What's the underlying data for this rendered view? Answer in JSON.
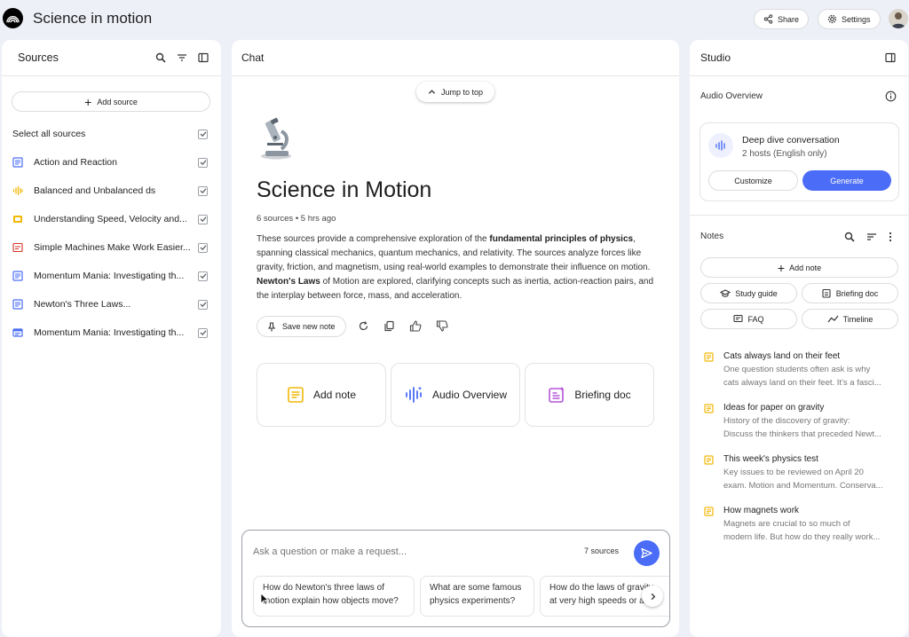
{
  "app": {
    "title": "Science in motion"
  },
  "header": {
    "share_label": "Share",
    "settings_label": "Settings"
  },
  "sources": {
    "title": "Sources",
    "add_label": "Add source",
    "select_all_label": "Select all sources",
    "items": [
      {
        "label": "Action and Reaction",
        "icon": "doc-icon",
        "color": "#4a6cf7"
      },
      {
        "label": "Balanced and Unbalanced ds",
        "icon": "audio-icon",
        "color": "#f2b807"
      },
      {
        "label": "Understanding Speed, Velocity and...",
        "icon": "slides-icon",
        "color": "#f2b807"
      },
      {
        "label": "Simple Machines Make Work Easier...",
        "icon": "pdf-icon",
        "color": "#d93025"
      },
      {
        "label": "Momentum Mania: Investigating th...",
        "icon": "doc-icon",
        "color": "#4a6cf7"
      },
      {
        "label": "Newton's Three Laws...",
        "icon": "doc-icon",
        "color": "#4a6cf7"
      },
      {
        "label": "Momentum Mania: Investigating th...",
        "icon": "web-icon",
        "color": "#4a6cf7"
      }
    ]
  },
  "chat": {
    "title": "Chat",
    "jump_label": "Jump to top",
    "notebook_title": "Science in Motion",
    "meta": "6 sources • 5 hrs ago",
    "summary": {
      "p1": "These sources provide a comprehensive exploration of the ",
      "b1": "fundamental principles of physics",
      "p2": ", spanning classical mechanics, quantum mechanics, and relativity. The sources analyze forces like gravity, friction, and magnetism, using real-world examples to demonstrate their influence on motion. ",
      "b2": "Newton's Laws",
      "p3": " of Motion are explored, clarifying concepts such as inertia, action-reaction pairs, and the interplay between force, mass, and acceleration."
    },
    "save_note_label": "Save new note",
    "cards": [
      {
        "label": "Add note"
      },
      {
        "label": "Audio Overview"
      },
      {
        "label": "Briefing doc"
      }
    ],
    "input_placeholder": "Ask a question or make a request...",
    "sources_count": "7 sources",
    "suggestions": [
      "How do Newton's three laws of motion explain how objects move?",
      "What are some famous physics experiments?",
      "How do the laws of gravity at very high speeds or a..."
    ]
  },
  "studio": {
    "title": "Studio",
    "audio_overview_label": "Audio Overview",
    "deep_dive_title": "Deep dive conversation",
    "deep_dive_sub": "2 hosts (English only)",
    "customize_label": "Customize",
    "generate_label": "Generate",
    "notes_label": "Notes",
    "add_note_label": "Add note",
    "study_guide_label": "Study guide",
    "briefing_doc_label": "Briefing doc",
    "faq_label": "FAQ",
    "timeline_label": "Timeline",
    "notes": [
      {
        "title": "Cats always land on their feet",
        "line1": "One question students often ask is why",
        "line2": "cats always land on their feet. It's a fasci..."
      },
      {
        "title": "Ideas for paper on gravity",
        "line1": "History of the discovery of gravity:",
        "line2": "Discuss the thinkers that preceded Newt..."
      },
      {
        "title": "This week's physics test",
        "line1": "Key issues to be reviewed on April 20",
        "line2": "exam. Motion and Momentum. Conserva..."
      },
      {
        "title": "How magnets work",
        "line1": "Magnets are crucial to so much of",
        "line2": "modern life. But how do they really work..."
      }
    ]
  },
  "colors": {
    "accent": "#4a6cf7",
    "note_yellow": "#f2b807",
    "briefing_purple": "#b455d9"
  }
}
